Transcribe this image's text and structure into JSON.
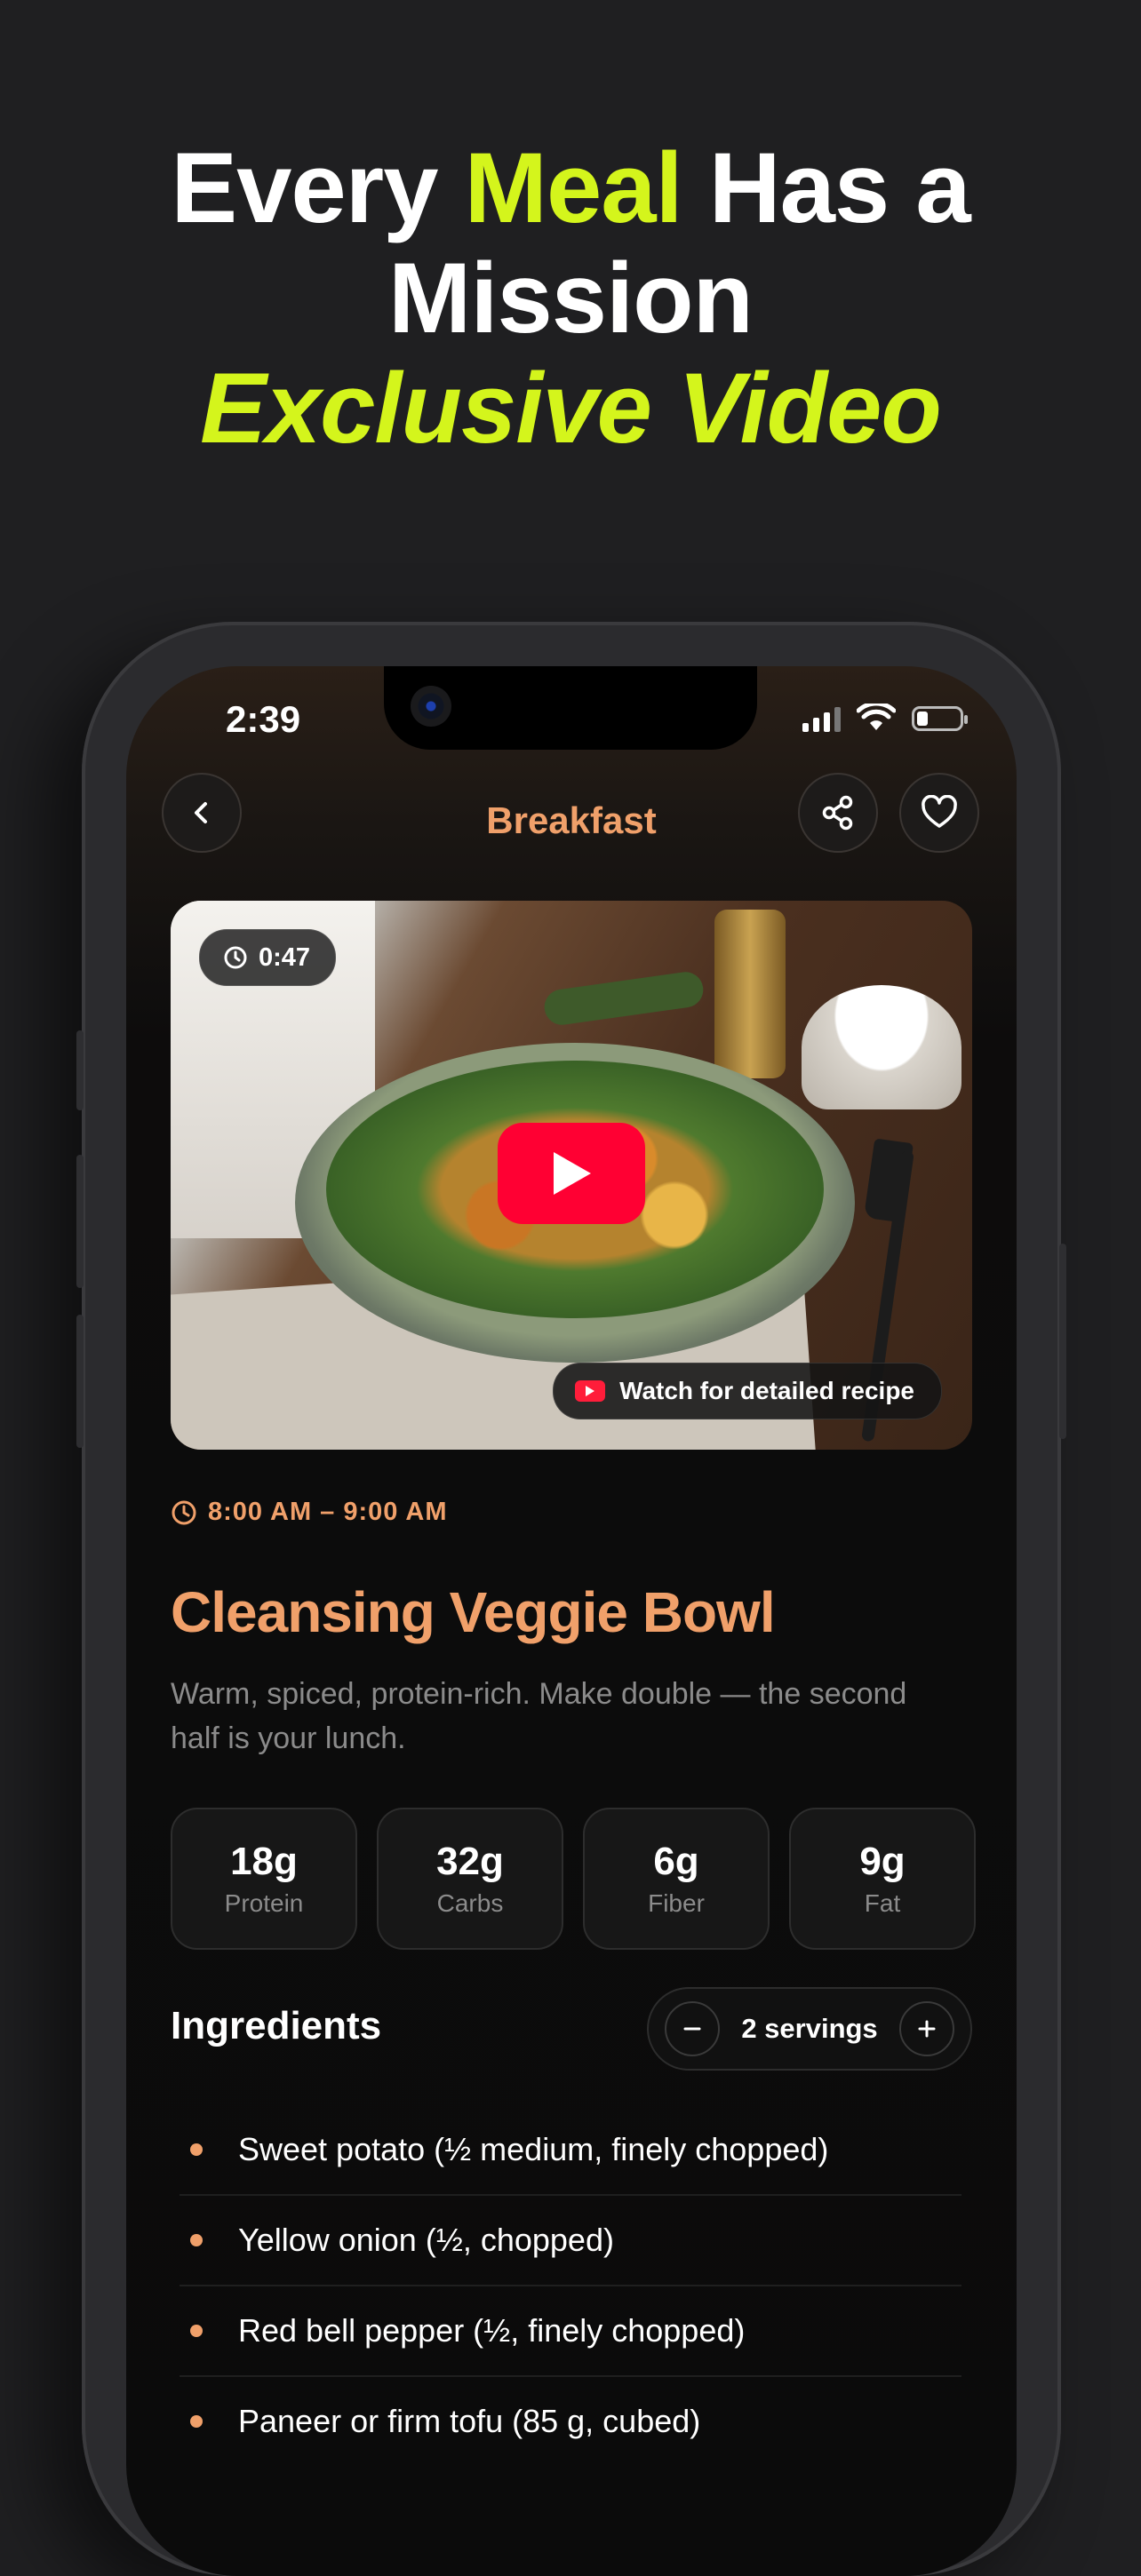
{
  "headline": {
    "line1_pre": "Every ",
    "line1_accent": "Meal",
    "line1_post": " Has a",
    "line2": "Mission",
    "line3": "Exclusive Video"
  },
  "status_bar": {
    "time": "2:39"
  },
  "nav": {
    "title": "Breakfast"
  },
  "video": {
    "duration": "0:47",
    "watch_label": "Watch for detailed recipe"
  },
  "meal": {
    "time_range": "8:00 AM – 9:00 AM",
    "title": "Cleansing Veggie Bowl",
    "description": "Warm, spiced, protein-rich. Make double — the second half is your lunch."
  },
  "macros": [
    {
      "value": "18g",
      "label": "Protein"
    },
    {
      "value": "32g",
      "label": "Carbs"
    },
    {
      "value": "6g",
      "label": "Fiber"
    },
    {
      "value": "9g",
      "label": "Fat"
    }
  ],
  "ingredients": {
    "title": "Ingredients",
    "servings_label": "2 servings",
    "items": [
      "Sweet potato (½ medium, finely chopped)",
      "Yellow onion (½, chopped)",
      "Red bell pepper (½, finely chopped)",
      "Paneer or firm tofu (85 g, cubed)"
    ]
  },
  "colors": {
    "background": "#1f1f21",
    "headline_accent": "#d4f51c",
    "brand_orange": "#f0a06a",
    "youtube_red": "#ff0033"
  }
}
